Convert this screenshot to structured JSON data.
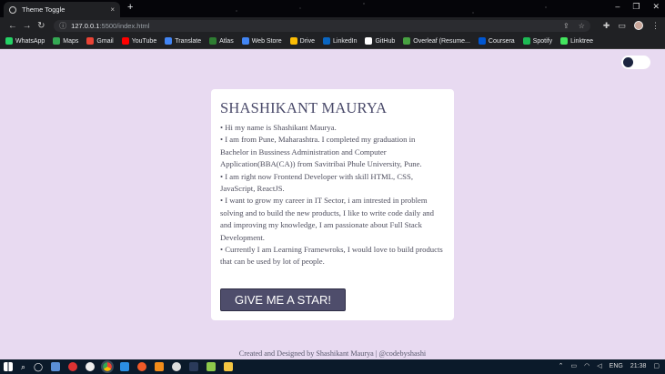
{
  "browser": {
    "tab_title": "Theme Toggle",
    "tab_close": "×",
    "new_tab": "+",
    "url_host": "127.0.0.1",
    "url_path": ":5500/index.html",
    "window_controls": [
      "–",
      "❐",
      "✕"
    ]
  },
  "bookmarks": [
    {
      "label": "WhatsApp",
      "color": "#25d366"
    },
    {
      "label": "Maps",
      "color": "#34a853"
    },
    {
      "label": "Gmail",
      "color": "#ea4335"
    },
    {
      "label": "YouTube",
      "color": "#ff0000"
    },
    {
      "label": "Translate",
      "color": "#4285f4"
    },
    {
      "label": "Atlas",
      "color": "#2e7d32"
    },
    {
      "label": "Web Store",
      "color": "#4285f4"
    },
    {
      "label": "Drive",
      "color": "#fbbc04"
    },
    {
      "label": "LinkedIn",
      "color": "#0a66c2"
    },
    {
      "label": "GitHub",
      "color": "#ffffff"
    },
    {
      "label": "Overleaf (Resume...",
      "color": "#47a141"
    },
    {
      "label": "Coursera",
      "color": "#0056d2"
    },
    {
      "label": "Spotify",
      "color": "#1db954"
    },
    {
      "label": "Linktree",
      "color": "#43e55e"
    }
  ],
  "card": {
    "name": "SHASHIKANT MAURYA",
    "bio": [
      "• Hi my name is Shashikant Maurya.",
      "• I am from Pune, Maharashtra. I completed my graduation in Bachelor in Bussiness Administration and Computer   Application(BBA(CA)) from Savitribai Phule University, Pune.",
      "• I am right now Frontend Developer with skill HTML, CSS, JavaScript, ReactJS.",
      "• I want to grow my career in IT Sector, i am intrested in problem solving and to build the new products, I like to write code   daily and and improving my knowledge, I am passionate about Full Stack Development.",
      "• Currently I am Learning Framewroks, I would love to build products that can be used by lot of people."
    ],
    "button_label": "GIVE ME A STAR!"
  },
  "footer": "Created and Designed by Shashikant Maurya | @codebyshashi",
  "taskbar": {
    "lang": "ENG",
    "time": "21:38"
  },
  "colors": {
    "page_bg": "#e8daf1",
    "button_bg": "#4e4d6b",
    "toggle_knob": "#1c2440"
  }
}
